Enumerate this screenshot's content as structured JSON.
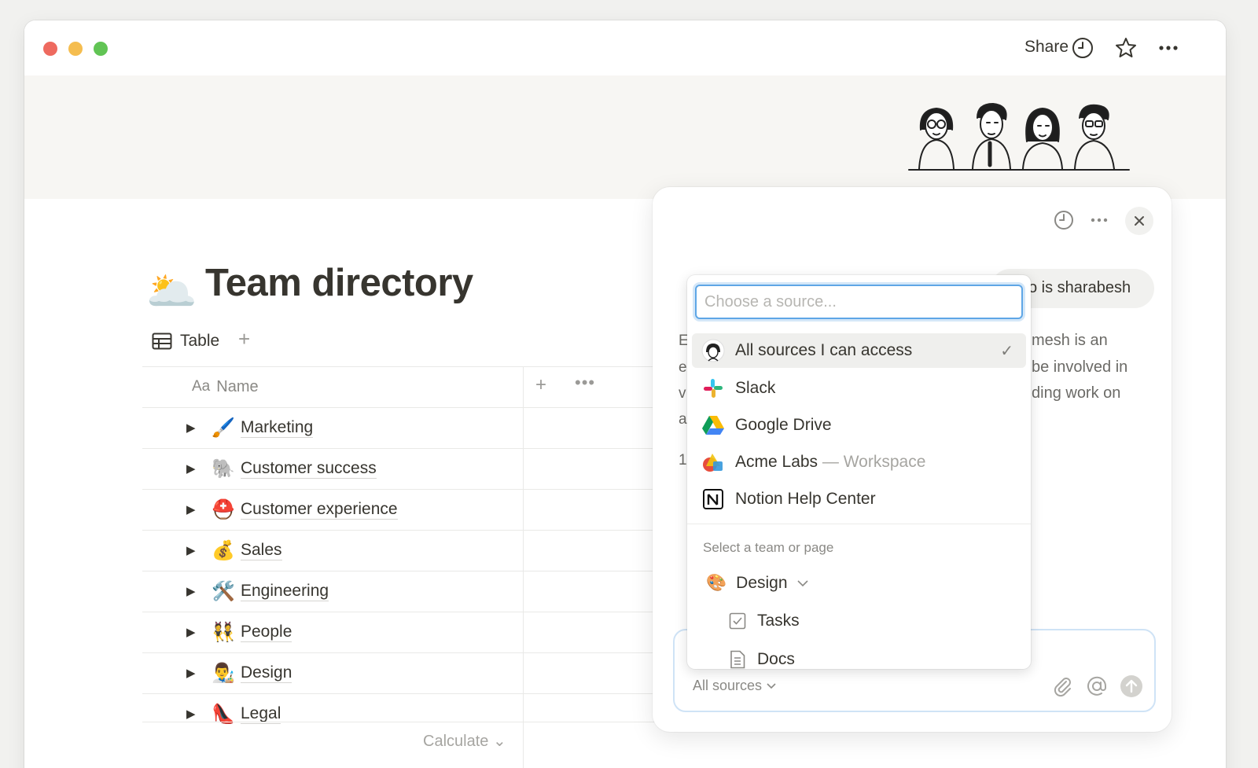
{
  "window": {
    "share_label": "Share"
  },
  "page": {
    "title": "Team directory",
    "title_emoji": "🌥️",
    "view_tab_label": "Table",
    "add_view_symbol": "+"
  },
  "table": {
    "name_column_prefix": "Aa",
    "name_column": "Name",
    "add_column_symbol": "+",
    "more_symbol": "•••",
    "rows": [
      {
        "emoji": "🖌️",
        "name": "Marketing"
      },
      {
        "emoji": "🐘",
        "name": "Customer success"
      },
      {
        "emoji": "⛑️",
        "name": "Customer experience"
      },
      {
        "emoji": "💰",
        "name": "Sales"
      },
      {
        "emoji": "🛠️",
        "name": "Engineering"
      },
      {
        "emoji": "👯",
        "name": "People"
      },
      {
        "emoji": "👨‍🎨",
        "name": "Design"
      },
      {
        "emoji": "👠",
        "name": "Legal"
      }
    ],
    "calculate_label": "Calculate"
  },
  "ai_panel": {
    "chip_text": "o is sharabesh",
    "background_lines": [
      "mesh is an",
      "be involved in",
      "ding work on"
    ],
    "background_left": [
      "E",
      "e",
      "v",
      "a",
      "1"
    ],
    "input_sources_label": "All sources"
  },
  "source_dropdown": {
    "search_placeholder": "Choose a source...",
    "options": [
      {
        "label": "All sources I can access",
        "icon": "avatar-icon",
        "selected": true
      },
      {
        "label": "Slack",
        "icon": "slack-icon",
        "selected": false
      },
      {
        "label": "Google Drive",
        "icon": "google-drive-icon",
        "selected": false
      },
      {
        "label": "Acme Labs",
        "suffix": " — Workspace",
        "icon": "workspace-icon",
        "selected": false
      },
      {
        "label": "Notion Help Center",
        "icon": "notion-icon",
        "selected": false
      }
    ],
    "section_label": "Select a team or page",
    "team": {
      "label": "Design",
      "emoji": "🎨"
    },
    "team_pages": [
      {
        "label": "Tasks",
        "icon": "checkbox-icon"
      },
      {
        "label": "Docs",
        "icon": "document-icon"
      }
    ]
  },
  "colors": {
    "traffic_red": "#ee6a5f",
    "traffic_yellow": "#f5bd4f",
    "traffic_green": "#61c454",
    "focus_blue": "#5ea6e6"
  }
}
